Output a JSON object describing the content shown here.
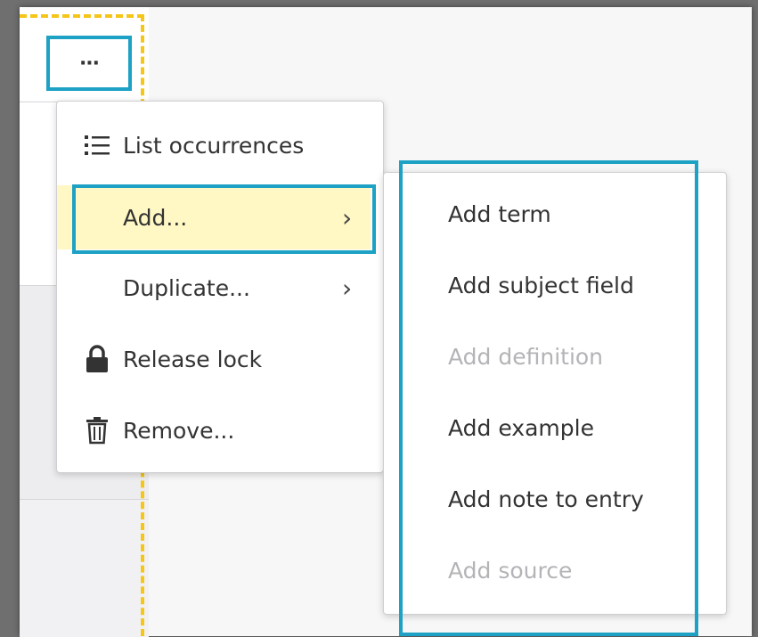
{
  "toolbar": {
    "more_label": "···"
  },
  "menu": {
    "items": [
      {
        "label": "List occurrences",
        "icon": "list-icon"
      },
      {
        "label": "Add...",
        "icon": "",
        "has_submenu": true,
        "highlighted": true
      },
      {
        "label": "Duplicate...",
        "icon": "",
        "has_submenu": true
      },
      {
        "label": "Release lock",
        "icon": "lock-icon"
      },
      {
        "label": "Remove...",
        "icon": "trash-icon"
      }
    ],
    "chevron": "›"
  },
  "submenu": {
    "items": [
      {
        "label": "Add term",
        "enabled": true
      },
      {
        "label": "Add subject field",
        "enabled": true
      },
      {
        "label": "Add definition",
        "enabled": false
      },
      {
        "label": "Add example",
        "enabled": true
      },
      {
        "label": "Add note to entry",
        "enabled": true
      },
      {
        "label": "Add source",
        "enabled": false
      }
    ]
  },
  "colors": {
    "highlight_frame": "#1da1c4",
    "selection_dash": "#f5c518",
    "hover_bg": "#fff7c4",
    "disabled_text": "#b4b4b8"
  }
}
